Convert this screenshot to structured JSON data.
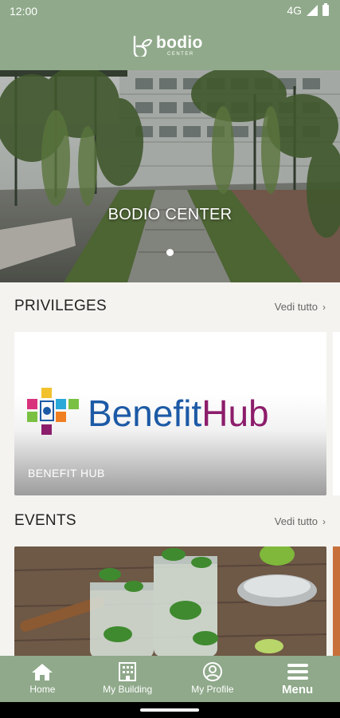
{
  "status_bar": {
    "time": "12:00",
    "network": "4G",
    "icons": [
      "signal-icon",
      "battery-icon"
    ]
  },
  "header": {
    "logo_text": "bodio",
    "logo_subtext": "CENTER",
    "background_color": "#8fa98a"
  },
  "hero": {
    "title": "BODIO CENTER",
    "carousel_pages": 1,
    "active_page": 1
  },
  "sections": {
    "privileges": {
      "title": "PRIVILEGES",
      "see_all_label": "Vedi tutto",
      "cards": [
        {
          "label": "BENEFIT HUB",
          "logo_text_part1": "Benefit",
          "logo_text_part2": "Hub"
        }
      ]
    },
    "events": {
      "title": "EVENTS",
      "see_all_label": "Vedi tutto",
      "cards": [
        {
          "image": "mojito-drinks-photo"
        }
      ]
    }
  },
  "bottom_nav": {
    "items": [
      {
        "label": "Home",
        "icon": "home-icon"
      },
      {
        "label": "My Building",
        "icon": "building-icon"
      },
      {
        "label": "My Profile",
        "icon": "profile-icon"
      },
      {
        "label": "Menu",
        "icon": "menu-icon"
      }
    ],
    "active_index": 3
  },
  "colors": {
    "accent_green": "#8fa98a",
    "page_background": "#f4f3ef",
    "benefit_blue": "#1c5aa6",
    "benefit_purple": "#8c1d6b"
  }
}
